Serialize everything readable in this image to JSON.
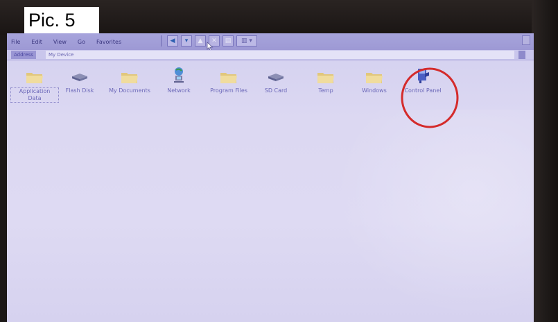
{
  "overlay": {
    "pic_label": "Pic. 5"
  },
  "menubar": {
    "items": [
      "File",
      "Edit",
      "View",
      "Go",
      "Favorites"
    ]
  },
  "toolbar": {
    "buttons": [
      {
        "name": "back-arrow-icon",
        "glyph": "◀"
      },
      {
        "name": "dropdown-icon",
        "glyph": "▾"
      },
      {
        "name": "up-folder-icon",
        "glyph": "▲"
      },
      {
        "name": "delete-icon",
        "glyph": "✕"
      },
      {
        "name": "properties-icon",
        "glyph": "▤"
      },
      {
        "name": "views-icon",
        "glyph": "▥ ▾"
      }
    ]
  },
  "addressbar": {
    "label": "Address",
    "value": "My Device"
  },
  "files": [
    {
      "label": "Application Data",
      "icon": "folder-icon",
      "selected": true
    },
    {
      "label": "Flash Disk",
      "icon": "drive-icon"
    },
    {
      "label": "My Documents",
      "icon": "folder-icon"
    },
    {
      "label": "Network",
      "icon": "network-icon"
    },
    {
      "label": "Program Files",
      "icon": "folder-icon"
    },
    {
      "label": "SD Card",
      "icon": "drive-icon"
    },
    {
      "label": "Temp",
      "icon": "folder-icon"
    },
    {
      "label": "Windows",
      "icon": "folder-icon"
    },
    {
      "label": "Control Panel",
      "icon": "control-panel-icon",
      "highlighted": true
    }
  ],
  "colors": {
    "desktop_bg": "#dcd8f2",
    "menubar_bg": "#a7a4dc",
    "label_text": "#6b67b8",
    "highlight": "#d42b2b",
    "folder": "#ead690"
  }
}
